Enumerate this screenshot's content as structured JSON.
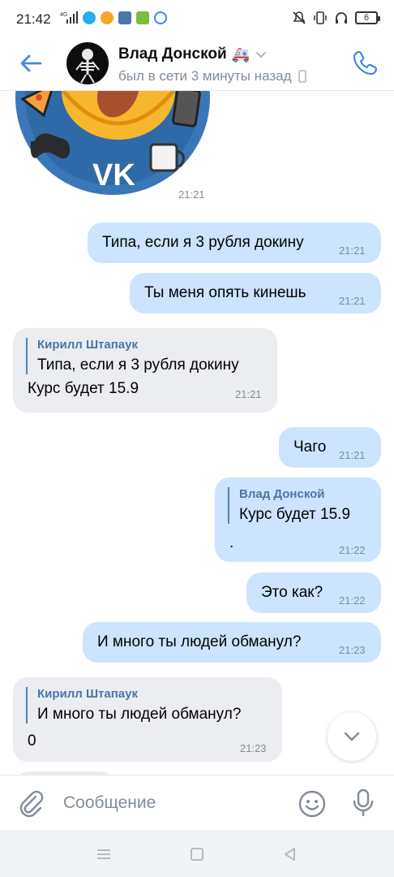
{
  "status_bar": {
    "time": "21:42",
    "network": "4G",
    "battery": "6"
  },
  "header": {
    "title": "Влад Донской",
    "title_emoji": "🚑",
    "status": "был в сети 3 минуты назад"
  },
  "sticker": {
    "time": "21:21"
  },
  "messages": [
    {
      "dir": "out",
      "text": "Типа, если я 3 рубля докину",
      "time": "21:21"
    },
    {
      "dir": "out",
      "text": "Ты меня опять кинешь",
      "time": "21:21"
    },
    {
      "dir": "in",
      "reply_author": "Кирилл Штапаук",
      "reply_text": "Типа, если я 3 рубля докину",
      "text": "Курс будет 15.9",
      "time": "21:21"
    },
    {
      "dir": "out",
      "text": "Чаго",
      "time": "21:21"
    },
    {
      "dir": "out",
      "reply_author": "Влад Донской",
      "reply_text": "Курс будет 15.9",
      "text": ".",
      "time": "21:22"
    },
    {
      "dir": "out",
      "text": "Это как?",
      "time": "21:22"
    },
    {
      "dir": "out",
      "text": "И много ты людей обманул?",
      "time": "21:23"
    },
    {
      "dir": "in",
      "reply_author": "Кирилл Штапаук",
      "reply_text": "И много ты людей обманул?",
      "text": "0",
      "time": "21:23"
    }
  ],
  "composer": {
    "placeholder": "Сообщение"
  },
  "colors": {
    "accent": "#4a76a8",
    "outgoing": "#cce4ff",
    "incoming": "#ebedf0"
  }
}
